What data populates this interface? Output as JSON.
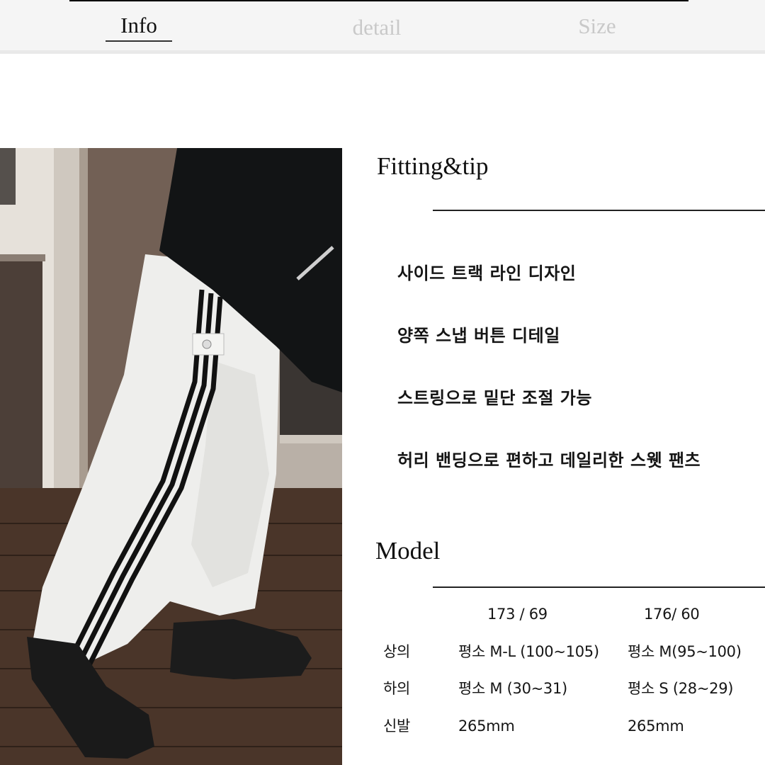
{
  "tabs": [
    {
      "label": "Info",
      "active": true
    },
    {
      "label": "detail",
      "active": false
    },
    {
      "label": "Size",
      "active": false
    }
  ],
  "colors": {
    "tab_active": "#111111",
    "tab_inactive": "#c9c9c9",
    "tabbar_bg": "#f5f5f5"
  },
  "photo": {
    "description": "Model wearing white track pants with black side stripes, black top and black chunky boots on wooden floor"
  },
  "fitting": {
    "title": "Fitting&tip",
    "tips": [
      "사이드 트랙 라인 디자인",
      "양쪽 스냅 버튼 디테일",
      "스트링으로 밑단 조절 가능",
      "허리 밴딩으로 편하고 데일리한 스웻 팬츠"
    ]
  },
  "model": {
    "title": "Model",
    "headers": [
      "173 / 69",
      "176/ 60"
    ],
    "rows": [
      {
        "label": "상의",
        "values": [
          "평소 M-L (100~105)",
          "평소 M(95~100)"
        ]
      },
      {
        "label": "하의",
        "values": [
          "평소 M (30~31)",
          "평소 S (28~29)"
        ]
      },
      {
        "label": "신발",
        "values": [
          "265mm",
          "265mm"
        ]
      }
    ]
  }
}
